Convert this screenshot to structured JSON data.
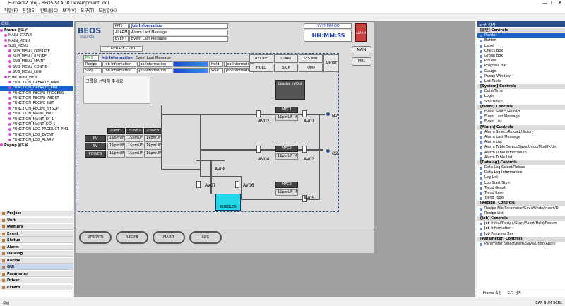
{
  "window": {
    "title": "Furnace2.proj - BEOS-SCADA Development Tool"
  },
  "menu": [
    "파일(F)",
    "편집(E)",
    "컨트롤(C)",
    "보기(V)",
    "도구(T)",
    "도움말(H)"
  ],
  "left_panel": {
    "title": "GUI",
    "tree": [
      {
        "label": "Frame 윈도우",
        "b": true
      },
      {
        "label": "MAIN_STATUS"
      },
      {
        "label": "MAIN_MENU"
      },
      {
        "label": "SUB_MENU"
      },
      {
        "label": "SUB_MENU_OPERATE"
      },
      {
        "label": "SUB_MENU_RECIPE"
      },
      {
        "label": "SUB_MENU_MAINT"
      },
      {
        "label": "SUB_MENU_CONFIG"
      },
      {
        "label": "SUB_MENU_LOG"
      },
      {
        "label": "FUNCTION_VIEW"
      },
      {
        "label": "FUNCTION_OPERATE_MAIN"
      },
      {
        "label": "FUNCTION_OPERATE_PM1",
        "sel": true
      },
      {
        "label": "FUNCTION_RECIPE_PROCESS"
      },
      {
        "label": "FUNCTION_RECIPE_ABORT"
      },
      {
        "label": "FUNCTION_RECIPE_INIT"
      },
      {
        "label": "FUNCTION_RECIPE_SYSUP"
      },
      {
        "label": "FUNCTION_MAINT_PM1"
      },
      {
        "label": "FUNCTION_MAINT_DI_1"
      },
      {
        "label": "FUNCTION_MAINT_DO_1"
      },
      {
        "label": "FUNCTION_LOG_PRODUCT_PM1"
      },
      {
        "label": "FUNCTION_LOG_EVENT"
      },
      {
        "label": "FUNCTION_LOG_ALARM"
      },
      {
        "label": "Popup 윈도우",
        "b": true
      }
    ],
    "sections": [
      "Project",
      "Unit",
      "Memory",
      "Event",
      "Status",
      "Alarm",
      "Datalog",
      "Recipe",
      "GUI",
      "Parameter",
      "Driver",
      "Extern"
    ]
  },
  "header": {
    "logo": "BEOS",
    "logo_sub": "SOLUTION",
    "pm": "PM1",
    "job": "Job Information",
    "alarm_lbl": "ALARM",
    "alarm_msg": "Alarm Last Message",
    "event_lbl": "EVENT",
    "event_msg": "Event Last Message",
    "date": "YYYY-MM-DD",
    "time": "HH:MM:SS",
    "alarm_btn": "ALARM"
  },
  "side_buttons": {
    "main": "MAIN",
    "pm1": "PM1"
  },
  "operate": {
    "title": "OPERATE - PM1",
    "pm": "PM1",
    "job": "Job Information",
    "event": "Event Last Message",
    "recipe_lbl": "Recipe",
    "step_lbl": "Step",
    "job_info": "Job Information",
    "hold": "Hold",
    "wait": "Wait",
    "b_recipe": "RECIPE",
    "b_start": "START",
    "b_sysinit": "SYS INIT",
    "b_hold": "HOLD",
    "b_skip": "SKIP",
    "b_jump": "JUMP",
    "b_abort": "ABORT",
    "msg": "그룹을 선택해 주세요",
    "loader": "Loader In/Out"
  },
  "zone": {
    "headers": [
      "ZONE1",
      "ZONE2",
      "ZONE3"
    ],
    "rows": [
      "PV",
      "SV",
      "POWER"
    ],
    "val": "1$pmUF_"
  },
  "gas": {
    "mfc1": "MFC1",
    "mfc2": "MFC2",
    "mfc3": "MFC3",
    "mfc_val": "1$pmUF_MF",
    "n2": "N2",
    "o2": "O2",
    "av01": "AV01",
    "av02": "AV02",
    "av03": "AV03",
    "av04": "AV04",
    "av05": "AV05",
    "av06": "AV06",
    "av07": "AV07",
    "av08": "AV08",
    "bubbler": "BUBBLER"
  },
  "nav": [
    "OPERATE",
    "RECIPE",
    "MAINT",
    "LOG"
  ],
  "right_panel": {
    "title": "도구 상자",
    "items": [
      {
        "g": "[일반] Controls"
      },
      {
        "t": "Pointer",
        "s": true
      },
      {
        "t": "Button"
      },
      {
        "t": "Label"
      },
      {
        "t": "Check Box"
      },
      {
        "t": "Group Box"
      },
      {
        "t": "Picutre"
      },
      {
        "t": "Progress Bar"
      },
      {
        "t": "Gauge"
      },
      {
        "t": "Popup Window"
      },
      {
        "t": "List Table"
      },
      {
        "g": "[System] Controls"
      },
      {
        "t": "Date/Time"
      },
      {
        "t": "Login"
      },
      {
        "t": "ShutDown"
      },
      {
        "g": "[Event] Controls"
      },
      {
        "t": "Event Select/Reload"
      },
      {
        "t": "Event Last Message"
      },
      {
        "t": "Event List"
      },
      {
        "g": "[Alarm] Controls"
      },
      {
        "t": "Alarm Select/Reload/History"
      },
      {
        "t": "Alarm Last Message"
      },
      {
        "t": "Alarm List"
      },
      {
        "t": "Alarm Table Select/Save/Undo/Modify/Un"
      },
      {
        "t": "Alarm Table Information"
      },
      {
        "t": "Alarm Table List"
      },
      {
        "g": "[Datalog] Controls"
      },
      {
        "t": "Data Log Select/Reload"
      },
      {
        "t": "Data Log Information"
      },
      {
        "t": "Log List"
      },
      {
        "t": "Log Start/Stop"
      },
      {
        "t": "Trend Graph"
      },
      {
        "t": "Trend Item"
      },
      {
        "t": "Trend Tools"
      },
      {
        "g": "[Recipe] Controls"
      },
      {
        "t": "Recipe File/Parameter/Save/Undo/Insert/D"
      },
      {
        "t": "Recipe List"
      },
      {
        "g": "[Job] Controls"
      },
      {
        "t": "Job Initial/Recipe/Start/Abort/Hold/Resum"
      },
      {
        "t": "Job Information"
      },
      {
        "t": "Job Progress Bar"
      },
      {
        "g": "[Parameter] Controls"
      },
      {
        "t": "Parameter Select/Item/Save/Undo/Apply"
      }
    ],
    "tabs": [
      "Frame 속성",
      "도구 상자"
    ]
  },
  "status": {
    "left": "준비",
    "right": "CAP NUM SCRL"
  }
}
